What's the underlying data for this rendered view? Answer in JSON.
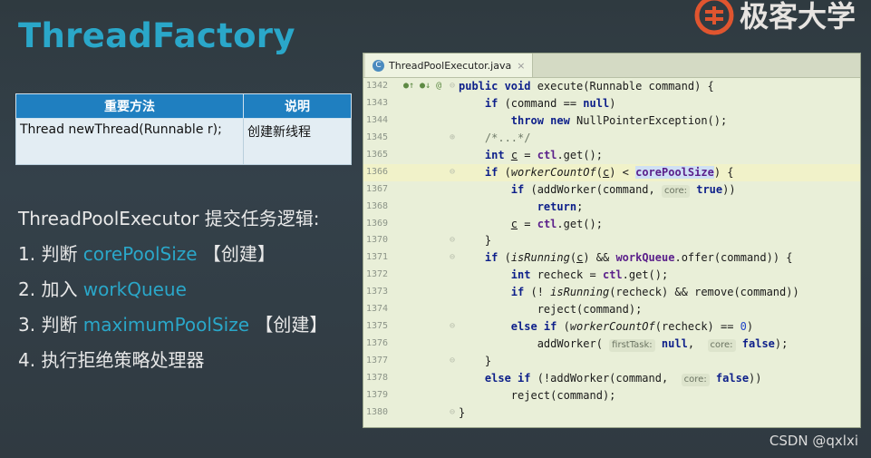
{
  "slide": {
    "title": "ThreadFactory",
    "logo_text": "极客大学",
    "table": {
      "headers": [
        "重要方法",
        "说明"
      ],
      "rows": [
        [
          "Thread newThread(Runnable r);",
          "创建新线程"
        ]
      ]
    },
    "logic_title": "ThreadPoolExecutor 提交任务逻辑:",
    "steps": [
      {
        "prefix": "1. 判断 ",
        "highlight": "corePoolSize",
        "suffix": " 【创建】"
      },
      {
        "prefix": "2. 加入 ",
        "highlight": "workQueue",
        "suffix": ""
      },
      {
        "prefix": "3. 判断 ",
        "highlight": "maximumPoolSize",
        "suffix": " 【创建】"
      },
      {
        "prefix": "4. 执行拒绝策略处理器",
        "highlight": "",
        "suffix": ""
      }
    ],
    "watermark": "CSDN @qxlxi"
  },
  "ide": {
    "tab_label": "ThreadPoolExecutor.java",
    "tab_close": "×",
    "gutter_marks": "●↑ ●↓ @",
    "line_numbers": [
      "1342",
      "1343",
      "1344",
      "1345",
      "1365",
      "1366",
      "1367",
      "1368",
      "1369",
      "1370",
      "1371",
      "1372",
      "1373",
      "1374",
      "1375",
      "1376",
      "1377",
      "1378",
      "1379",
      "1380"
    ],
    "colors": {
      "accent": "#2aa7c9",
      "table_header": "#1f7fc0",
      "editor_bg": "#e9efd8",
      "current_line": "#f1f2c9"
    }
  }
}
